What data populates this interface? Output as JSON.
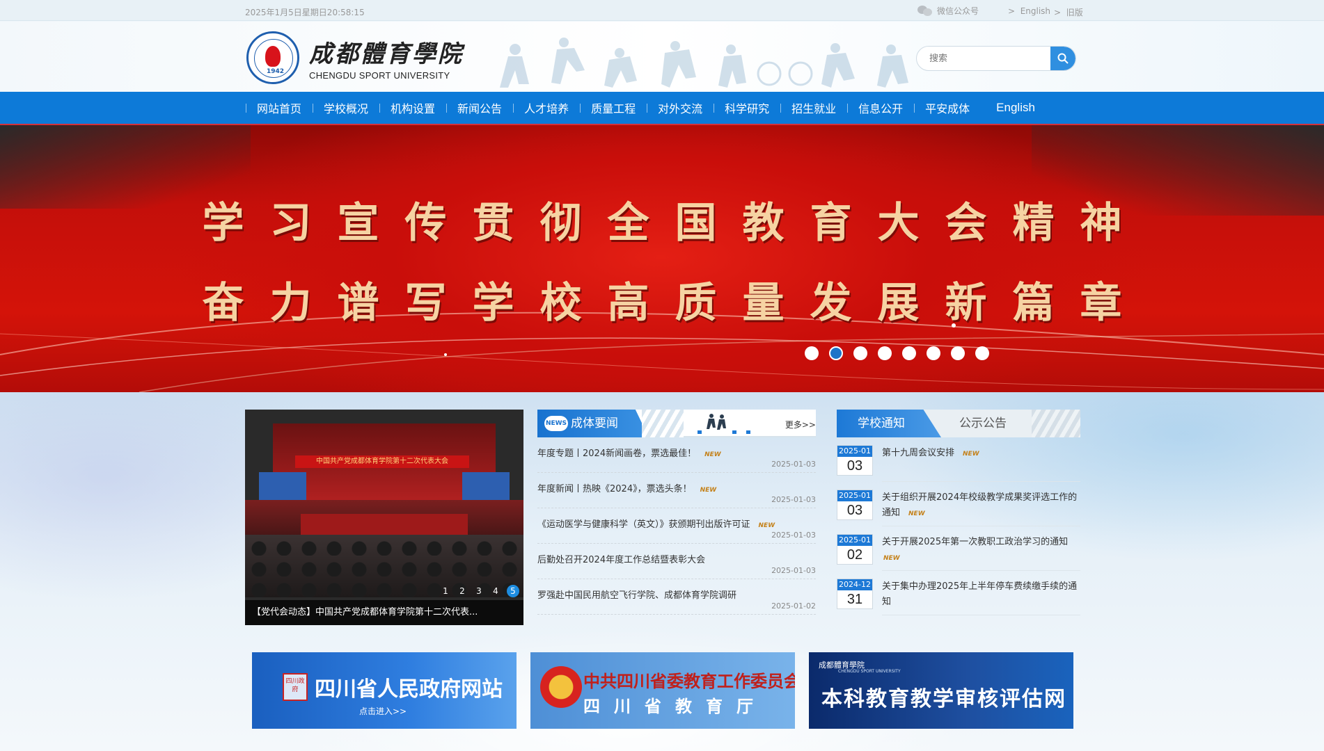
{
  "topbar": {
    "datetime": "2025年1月5日星期日20:58:15",
    "wechat_label": "微信公众号",
    "english_link": "English",
    "old_link": "旧版",
    "arrow": ">"
  },
  "header": {
    "logo_cn": "成都體育學院",
    "logo_en": "CHENGDU SPORT UNIVERSITY",
    "logo_year": "1942",
    "search_placeholder": "搜索"
  },
  "nav": {
    "items": [
      "网站首页",
      "学校概况",
      "机构设置",
      "新闻公告",
      "人才培养",
      "质量工程",
      "对外交流",
      "科学研究",
      "招生就业",
      "信息公开",
      "平安成体",
      "English"
    ]
  },
  "banner": {
    "line1": "学习宣传贯彻全国教育大会精神",
    "line2": "奋力谱写学校高质量发展新篇章",
    "slide_count": 8,
    "active_slide": 2
  },
  "photo": {
    "caption": "【党代会动态】中国共产党成都体育学院第十二次代表...",
    "stage_banner": "中国共产党成都体育学院第十二次代表大会",
    "pages": [
      "1",
      "2",
      "3",
      "4",
      "5"
    ],
    "active_page": "5"
  },
  "news": {
    "badge": "NEWS",
    "title": "成体要闻",
    "more": "更多>>",
    "new_tag": "NEW",
    "items": [
      {
        "title": "年度专题丨2024新闻画卷，票选最佳！",
        "date": "2025-01-03",
        "is_new": true
      },
      {
        "title": "年度新闻丨热映《2024》，票选头条！",
        "date": "2025-01-03",
        "is_new": true
      },
      {
        "title": "《运动医学与健康科学（英文）》获颁期刊出版许可证",
        "date": "2025-01-03",
        "is_new": true
      },
      {
        "title": "后勤处召开2024年度工作总结暨表彰大会",
        "date": "2025-01-03",
        "is_new": false
      },
      {
        "title": "罗强赴中国民用航空飞行学院、成都体育学院调研",
        "date": "2025-01-02",
        "is_new": false
      }
    ]
  },
  "notice": {
    "tab_active": "学校通知",
    "tab_inactive": "公示公告",
    "new_tag": "NEW",
    "items": [
      {
        "ym": "2025-01",
        "day": "03",
        "title": "第十九周会议安排",
        "is_new": true
      },
      {
        "ym": "2025-01",
        "day": "03",
        "title": "关于组织开展2024年校级教学成果奖评选工作的通知",
        "is_new": true
      },
      {
        "ym": "2025-01",
        "day": "02",
        "title": "关于开展2025年第一次教职工政治学习的通知",
        "is_new": true
      },
      {
        "ym": "2024-12",
        "day": "31",
        "title": "关于集中办理2025年上半年停车费续缴手续的通知",
        "is_new": false
      }
    ]
  },
  "links": {
    "sichuan_gov": {
      "title": "四川省人民政府网站",
      "sub": "点击进入>>",
      "seal": "四川政府"
    },
    "education_dept": {
      "title": "中共四川省委教育工作委员会",
      "sub": "四川省教育厅"
    },
    "audit": {
      "logo": "成都體育學院",
      "logo_en": "CHENGDU SPORT UNIVERSITY",
      "title": "本科教育教学审核评估网"
    }
  },
  "colors": {
    "nav_blue": "#0d7ad8",
    "accent_red": "#d3303a",
    "banner_red": "#d41309",
    "banner_text": "#f6d3a3",
    "new_tag": "#c4811a"
  }
}
